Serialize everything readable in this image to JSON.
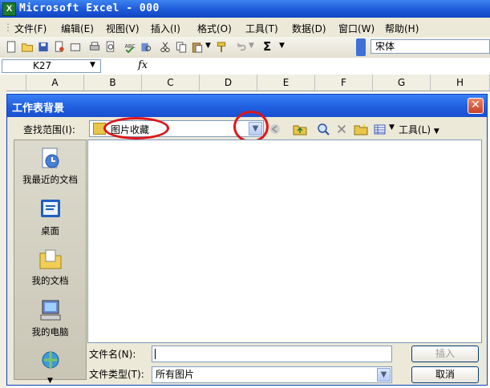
{
  "window": {
    "title": "Microsoft Excel - 000",
    "app_icon": "X"
  },
  "menu": [
    "文件(F)",
    "编辑(E)",
    "视图(V)",
    "插入(I)",
    "格式(O)",
    "工具(T)",
    "数据(D)",
    "窗口(W)",
    "帮助(H)"
  ],
  "toolbar": {
    "font_name": "宋体",
    "sigma": "Σ"
  },
  "formula_bar": {
    "cell_ref": "K27",
    "fx": "fx"
  },
  "columns": [
    "A",
    "B",
    "C",
    "D",
    "E",
    "F",
    "G",
    "H"
  ],
  "dialog": {
    "title": "工作表背景",
    "close": "✕",
    "look_in_label": "查找范围(I):",
    "look_in_value": "图片收藏",
    "tools_label": "工具(L)",
    "places": [
      {
        "label": "我最近的文档",
        "icon": "recent-documents-icon"
      },
      {
        "label": "桌面",
        "icon": "desktop-icon"
      },
      {
        "label": "我的文档",
        "icon": "my-documents-icon"
      },
      {
        "label": "我的电脑",
        "icon": "my-computer-icon"
      },
      {
        "label": "",
        "icon": "network-places-icon"
      }
    ],
    "file_name_label": "文件名(N):",
    "file_name_value": "",
    "file_type_label": "文件类型(T):",
    "file_type_value": "所有图片",
    "insert_button": "插入",
    "cancel_button": "取消"
  },
  "colors": {
    "annotation": "#e0141a",
    "title_blue": "#1f5fe0"
  }
}
